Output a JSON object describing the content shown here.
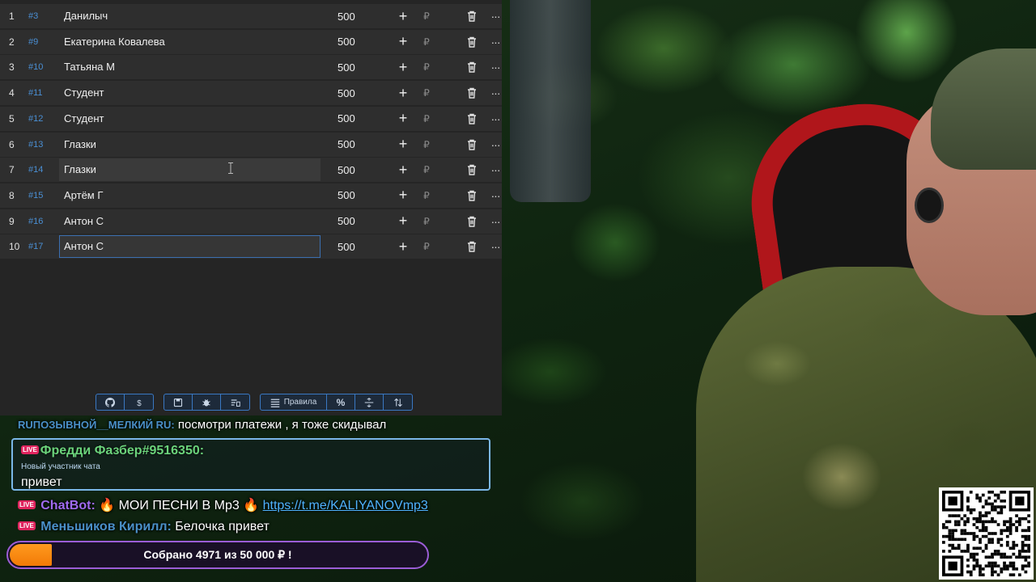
{
  "table": {
    "rows": [
      {
        "num": "1",
        "tag": "#3",
        "name": "Данилыч",
        "amount": "500",
        "currency": "₽"
      },
      {
        "num": "2",
        "tag": "#9",
        "name": "Екатерина Ковалева",
        "amount": "500",
        "currency": "₽"
      },
      {
        "num": "3",
        "tag": "#10",
        "name": "Татьяна М",
        "amount": "500",
        "currency": "₽"
      },
      {
        "num": "4",
        "tag": "#11",
        "name": "Студент",
        "amount": "500",
        "currency": "₽"
      },
      {
        "num": "5",
        "tag": "#12",
        "name": "Студент",
        "amount": "500",
        "currency": "₽"
      },
      {
        "num": "6",
        "tag": "#13",
        "name": "Глазки",
        "amount": "500",
        "currency": "₽"
      },
      {
        "num": "7",
        "tag": "#14",
        "name": "Глазки",
        "amount": "500",
        "currency": "₽"
      },
      {
        "num": "8",
        "tag": "#15",
        "name": "Артём Г",
        "amount": "500",
        "currency": "₽"
      },
      {
        "num": "9",
        "tag": "#16",
        "name": "Антон С",
        "amount": "500",
        "currency": "₽"
      },
      {
        "num": "10",
        "tag": "#17",
        "name": "Антон С",
        "amount": "500",
        "currency": "₽"
      }
    ],
    "plus_label": "+",
    "more_label": "···"
  },
  "toolbar": {
    "rules_label": "Правила",
    "percent_label": "%",
    "icons": [
      "github-icon",
      "dollar-icon",
      "save-icon",
      "bug-icon",
      "clear-list-icon",
      "list-icon",
      "percent-icon",
      "split-icon",
      "sort-icon"
    ]
  },
  "chat": {
    "top": {
      "user": "RUПОЗЫВНОЙ__МЕЛКИЙ RU:",
      "message": " посмотри платежи , я тоже скидывал"
    },
    "highlight": {
      "badge": "LIVE",
      "user": "Фредди Фазбер#9516350:",
      "subtitle": "Новый участник чата",
      "message": "привет"
    },
    "bot": {
      "badge": "LIVE",
      "user": "ChatBot:",
      "message": " 🔥 МОИ ПЕСНИ В Mp3 🔥 ",
      "link": "https://t.me/KALIYANOVmp3"
    },
    "last": {
      "badge": "LIVE",
      "user": "Меньшиков Кирилл:",
      "message": " Белочка привет"
    }
  },
  "goal": {
    "text": "Собрано 4971  из 50 000 ₽ !",
    "collected": 4971,
    "target": 50000,
    "progress": 0.09942,
    "fill_color": "#f27a06",
    "border_color": "#9b5dd6"
  },
  "colors": {
    "panel_bg": "#252525",
    "row_bg": "#2e2e2e",
    "tag_color": "#4a8fd4",
    "accent_blue": "#3a78c2",
    "chat_highlight_border": "#7bb7e8",
    "live_badge": "#e0245e"
  }
}
